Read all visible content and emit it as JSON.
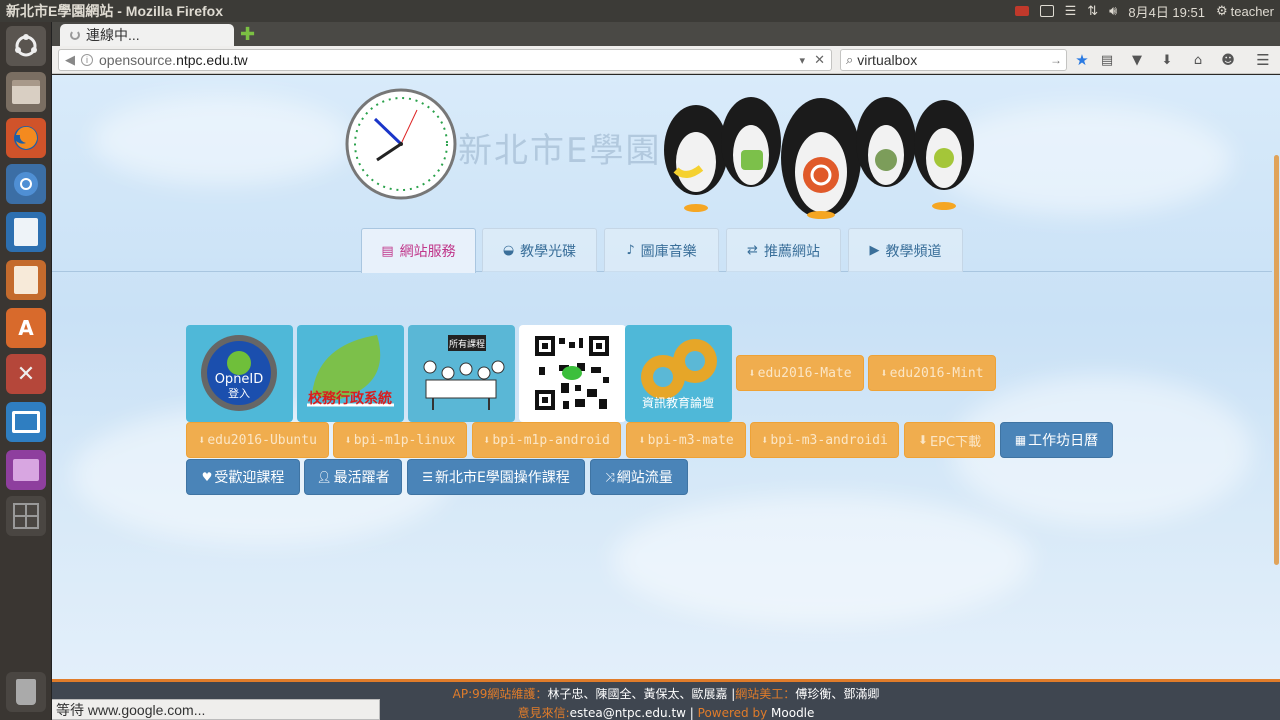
{
  "window": {
    "title": "新北市E學園網站 - Mozilla Firefox"
  },
  "panel": {
    "date_time": "8月4日 19:51",
    "user": "teacher"
  },
  "launcher": {
    "items": [
      "ubuntu-dash-icon",
      "files-icon",
      "firefox-icon",
      "chromium-icon",
      "writer-icon",
      "impress-icon",
      "software-center-icon",
      "settings-icon",
      "remote-desktop-icon",
      "app-icon",
      "workspace-icon",
      "trash-icon"
    ]
  },
  "browser": {
    "tab_label": "連線中...",
    "url_prefix": "opensource.",
    "url_host": "ntpc.edu.tw",
    "search_value": "virtualbox",
    "status": "等待 www.google.com..."
  },
  "colors": {
    "accent_orange": "#f0ad4e",
    "accent_blue": "#4a84b8",
    "active_tab": "#c0368a",
    "footer_bg": "#3f4650"
  },
  "header": {
    "site_title": "新北市E學園"
  },
  "tabs": [
    {
      "label": "網站服務",
      "icon": "service-icon"
    },
    {
      "label": "教學光碟",
      "icon": "disc-icon"
    },
    {
      "label": "圖庫音樂",
      "icon": "music-icon"
    },
    {
      "label": "推薦網站",
      "icon": "link-icon"
    },
    {
      "label": "教學頻道",
      "icon": "channel-icon"
    }
  ],
  "tiles": [
    {
      "label": "OpneID\n登入"
    },
    {
      "label": "校務行政系統"
    },
    {
      "label": "所有課程"
    },
    {
      "label": ""
    },
    {
      "label": "資訊教育論壇"
    }
  ],
  "buttons_row1": [
    "edu2016-Mate",
    "edu2016-Mint"
  ],
  "buttons_row2": [
    "edu2016-Ubuntu",
    "bpi-m1p-linux",
    "bpi-m1p-android",
    "bpi-m3-mate",
    "bpi-m3-androidi",
    "EPC下載"
  ],
  "buttons_row2_blue": "工作坊日曆",
  "buttons_row3": [
    "受歡迎課程",
    "最活躍者",
    "新北市E學園操作課程",
    "網站流量"
  ],
  "footer": {
    "line1_a": "AP:99網站維護：",
    "line1_b": "林子忠、陳國全、黃保太、歐展嘉 |",
    "line1_c": "網站美工：",
    "line1_d": "傅珍衡、鄧滿卿",
    "line2_a": "意見來信:",
    "line2_b": "estea@ntpc.edu.tw | ",
    "line2_c": "Powered by ",
    "line2_d": "Moodle"
  }
}
